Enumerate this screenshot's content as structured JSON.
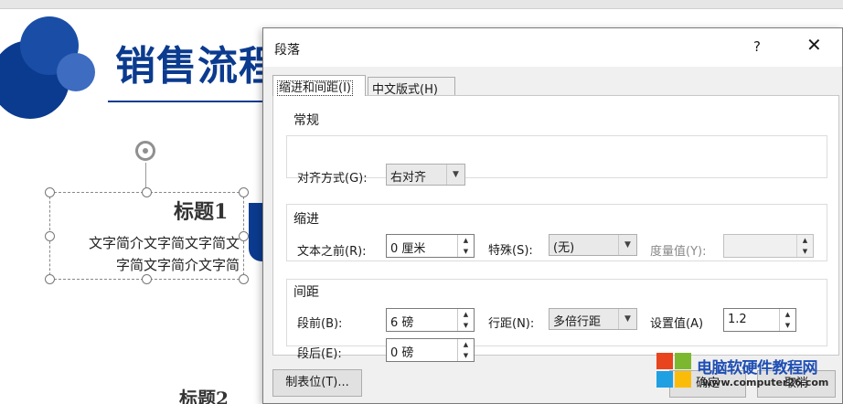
{
  "slide": {
    "title": "销售流程",
    "heading1": "标题1",
    "body_line1": "文字简介文字简文字简文",
    "body_line2": "字简文字简介文字简",
    "heading2": "标题2"
  },
  "dialog": {
    "title": "段落",
    "help": "?",
    "close": "✕",
    "tabs": [
      {
        "label": "缩进和间距(I)",
        "active": true
      },
      {
        "label": "中文版式(H)",
        "active": false
      }
    ],
    "general": {
      "title": "常规",
      "alignment_label": "对齐方式(G):",
      "alignment_value": "右对齐"
    },
    "indent": {
      "title": "缩进",
      "before_text_label": "文本之前(R):",
      "before_text_value": "0 厘米",
      "special_label": "特殊(S):",
      "special_value": "(无)",
      "measure_label": "度量值(Y):",
      "measure_value": ""
    },
    "spacing": {
      "title": "间距",
      "before_label": "段前(B):",
      "before_value": "6 磅",
      "line_spacing_label": "行距(N):",
      "line_spacing_value": "多倍行距",
      "set_value_label": "设置值(A)",
      "set_value": "1.2",
      "after_label": "段后(E):",
      "after_value": "0 磅"
    },
    "buttons": {
      "tabs": "制表位(T)...",
      "ok": "确定",
      "cancel": "取消"
    }
  },
  "watermark": {
    "title": "电脑软硬件教程网",
    "url": "www.computer26.com"
  },
  "colors": {
    "brand_blue": "#0b3b8f",
    "dialog_bg": "#f0f0f0",
    "watermark_blue": "#1f4fb4"
  }
}
